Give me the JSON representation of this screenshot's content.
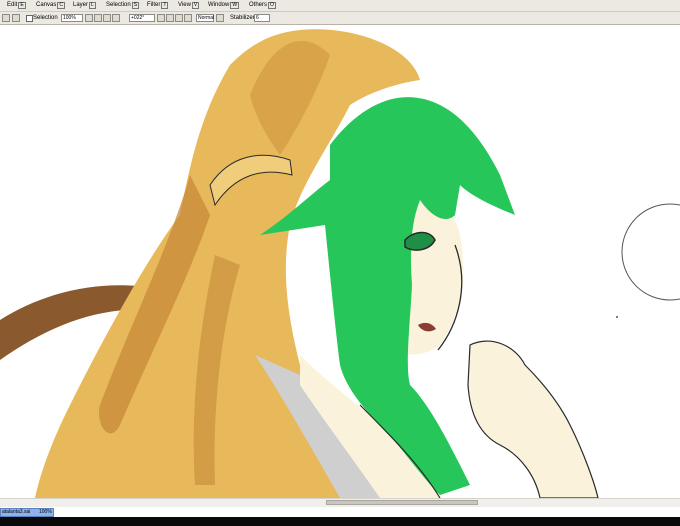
{
  "menu": {
    "items": [
      {
        "label": "Edit",
        "key": "E"
      },
      {
        "label": "Canvas",
        "key": "C"
      },
      {
        "label": "Layer",
        "key": "L"
      },
      {
        "label": "Selection",
        "key": "S"
      },
      {
        "label": "Filter",
        "key": "T"
      },
      {
        "label": "View",
        "key": "V"
      },
      {
        "label": "Window",
        "key": "W"
      },
      {
        "label": "Others",
        "key": "O"
      }
    ]
  },
  "toolbar": {
    "selection_label": "Selection",
    "zoom_value": "100%",
    "rotation_value": "+022°",
    "blend_mode": "Normal",
    "stabilizer_label": "Stabilizer",
    "stabilizer_value": "6"
  },
  "document": {
    "file_name": "atalanta3.sai",
    "zoom": "100%"
  },
  "colors": {
    "hair_blonde": "#e7b95a",
    "hair_shadow": "#c7893a",
    "hair_green": "#27c65a",
    "skin": "#fbf2dc",
    "sleeve_gray": "#cfcfcf",
    "line": "#2a2a2a",
    "tail": "#8a5a2e"
  }
}
